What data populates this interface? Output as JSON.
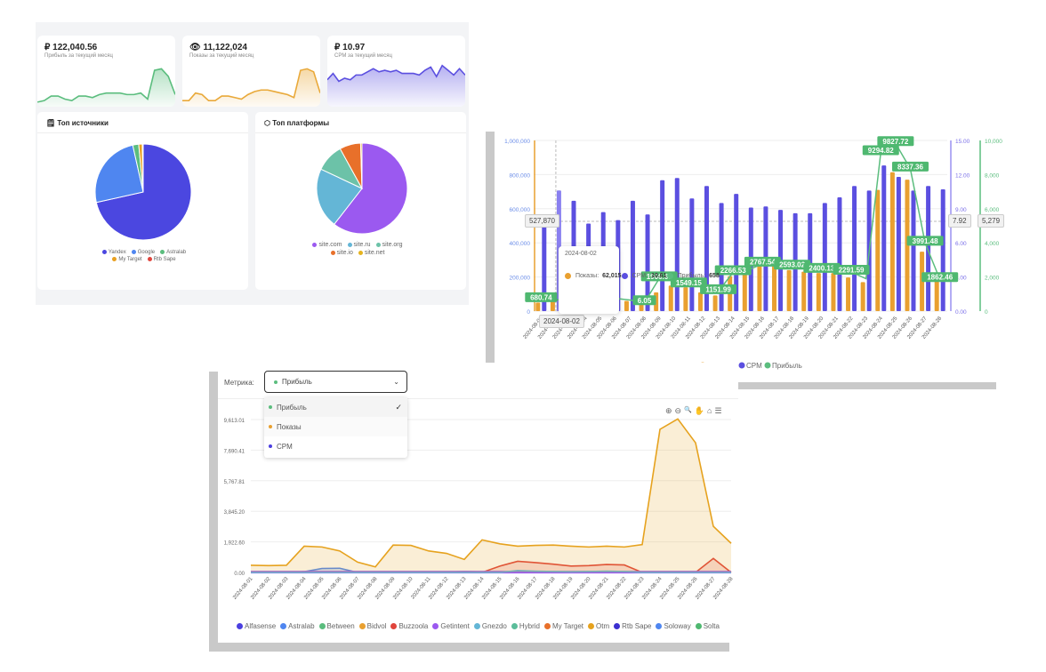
{
  "kpis": [
    {
      "value": "₽ 122,040.56",
      "label": "Прибыль за текущий месяц",
      "color": "#5bbd7e",
      "spark": [
        3,
        4,
        7,
        7,
        5,
        4,
        7,
        7,
        6,
        8,
        9,
        9,
        9,
        8,
        8,
        9,
        5,
        24,
        25,
        20,
        8
      ]
    },
    {
      "value": "11,122,024",
      "label": "Показы за текущий месяц",
      "color": "#e9a93a",
      "icon": "eye-icon",
      "spark": [
        4,
        4,
        9,
        8,
        4,
        4,
        7,
        7,
        6,
        5,
        8,
        10,
        11,
        11,
        10,
        9,
        8,
        6,
        24,
        25,
        23,
        9
      ]
    },
    {
      "value": "₽ 10.97",
      "label": "CPM за текущий месяц",
      "color": "#5b4fe0",
      "spark": [
        17,
        21,
        16,
        18,
        17,
        20,
        20,
        22,
        24,
        22,
        23,
        22,
        23,
        21,
        21,
        21,
        20,
        23,
        25,
        19,
        26,
        23,
        20,
        24,
        20
      ]
    }
  ],
  "sources": {
    "title": "Топ источники",
    "icon": "clipboard-icon",
    "chart_data": {
      "type": "pie",
      "labels": [
        "Yandex",
        "Google",
        "Astralab",
        "My Target",
        "Rtb Sape"
      ],
      "values": [
        71.5,
        25,
        2,
        1.2,
        0.3
      ],
      "colors": [
        "#4b47e0",
        "#4f86f0",
        "#5bbd7e",
        "#e9a020",
        "#e0443c"
      ]
    }
  },
  "platforms": {
    "title": "Топ платформы",
    "icon": "cube-icon",
    "chart_data": {
      "type": "pie",
      "labels": [
        "site.com",
        "site.ru",
        "site.org",
        "site.io",
        "site.net"
      ],
      "values": [
        60.5,
        21.5,
        10,
        7.5,
        0.5
      ],
      "colors": [
        "#9b59f0",
        "#64b6d6",
        "#6cc2a8",
        "#e8702a",
        "#e5b31e"
      ]
    }
  },
  "bar_chart": {
    "chart_data": {
      "type": "bar",
      "x": [
        "2024-08-01",
        "2024-08-02",
        "2024-08-03",
        "2024-08-04",
        "2024-08-05",
        "2024-08-06",
        "2024-08-07",
        "2024-08-08",
        "2024-08-09",
        "2024-08-10",
        "2024-08-11",
        "2024-08-12",
        "2024-08-13",
        "2024-08-14",
        "2024-08-15",
        "2024-08-16",
        "2024-08-17",
        "2024-08-18",
        "2024-08-19",
        "2024-08-20",
        "2024-08-21",
        "2024-08-22",
        "2024-08-23",
        "2024-08-24",
        "2024-08-25",
        "2024-08-26",
        "2024-08-27",
        "2024-08-28"
      ],
      "series": [
        {
          "name": "Показы",
          "type": "bar",
          "axis": "left",
          "color": "#e9a030",
          "values": [
            50000,
            62015,
            70000,
            80000,
            75000,
            70000,
            60000,
            55000,
            110000,
            150000,
            140000,
            110000,
            92000,
            205000,
            215000,
            275000,
            266000,
            240000,
            231000,
            223000,
            223000,
            197000,
            170000,
            710000,
            814000,
            770000,
            348000,
            180000
          ]
        },
        {
          "name": "CPM",
          "type": "bar",
          "axis": "right1",
          "color": "#5b4fe0",
          "values": [
            7.8,
            10.61,
            9.7,
            7.7,
            8.7,
            8.0,
            9.7,
            8.5,
            11.5,
            11.7,
            9.9,
            11.0,
            9.5,
            10.3,
            9.1,
            9.2,
            8.9,
            8.6,
            8.6,
            9.5,
            10.0,
            11.0,
            10.6,
            12.8,
            11.8,
            10.6,
            11.0,
            10.7
          ]
        },
        {
          "name": "Прибыль",
          "type": "line",
          "axis": "right2",
          "color": "#5bbd7e",
          "values": [
            680.74,
            658,
            700,
            900,
            800,
            750,
            650,
            506.05,
            1906.67,
            1850,
            1549.15,
            1400,
            1151.99,
            2266.53,
            2400,
            2767.54,
            2700,
            2593.02,
            2500,
            2400.13,
            2350,
            2291.59,
            1900,
            9294.82,
            9827.72,
            8337.36,
            3991.48,
            1862.46
          ]
        }
      ],
      "data_labels": [
        [
          "2024-08-01",
          "680.74"
        ],
        [
          "2024-08-08",
          "6.05"
        ],
        [
          "2024-08-09",
          "1906.67"
        ],
        [
          "2024-08-11",
          "1549.15"
        ],
        [
          "2024-08-13",
          "1151.99"
        ],
        [
          "2024-08-14",
          "2266.53"
        ],
        [
          "2024-08-16",
          "2767.54"
        ],
        [
          "2024-08-18",
          "2593.02"
        ],
        [
          "2024-08-20",
          "2400.13"
        ],
        [
          "2024-08-22",
          "2291.59"
        ],
        [
          "2024-08-24",
          "9294.82"
        ],
        [
          "2024-08-25",
          "9827.72"
        ],
        [
          "2024-08-26",
          "8337.36"
        ],
        [
          "2024-08-27",
          "3991.48"
        ],
        [
          "2024-08-28",
          "1862.46"
        ]
      ],
      "yleft": {
        "ticks": [
          "0",
          "200,000",
          "400,000",
          "600,000",
          "800,000",
          "1,000,000"
        ],
        "range": [
          0,
          1000000
        ]
      },
      "yright1": {
        "ticks": [
          "0.00",
          "3.00",
          "6.00",
          "9.00",
          "12.00",
          "15.00"
        ],
        "range": [
          0,
          15
        ]
      },
      "yright2": {
        "ticks": [
          "0",
          "2,000",
          "4,000",
          "6,000",
          "8,000",
          "10,000"
        ],
        "range": [
          0,
          10000
        ]
      },
      "legend": "bottom",
      "grid": true
    },
    "crosshair": {
      "left": "527,870",
      "cpm": "7.92",
      "profit": "5,279",
      "x": "2024-08-02"
    },
    "tooltip": {
      "date": "2024-08-02",
      "rows": [
        {
          "label": "Показы:",
          "value": "62,015",
          "color": "#e9a030"
        },
        {
          "label": "CPM:",
          "value": "10.61",
          "color": "#5b4fe0"
        },
        {
          "label": "Прибыль:",
          "value": "658",
          "color": "#5bbd7e"
        }
      ]
    }
  },
  "line_chart": {
    "metric_label": "Метрика:",
    "selected": "Прибыль",
    "selected_color": "#5bbd7e",
    "options": [
      {
        "label": "Прибыль",
        "color": "#5bbd7e",
        "checked": true
      },
      {
        "label": "Показы",
        "color": "#e9a030"
      },
      {
        "label": "CPM",
        "color": "#4b3fe0"
      }
    ],
    "toolbar": [
      "zoom-in-icon",
      "zoom-out-icon",
      "search-icon",
      "hand-icon",
      "home-icon",
      "menu-icon"
    ],
    "chart_data": {
      "type": "area",
      "yticks": [
        "0.00",
        "1,922.60",
        "3,845.20",
        "5,767.81",
        "7,690.41",
        "9,613.01"
      ],
      "ylim": [
        0,
        9613.01
      ],
      "legend": "bottom",
      "grid": true,
      "x": [
        "2024-08-01",
        "2024-08-02",
        "2024-08-03",
        "2024-08-04",
        "2024-08-05",
        "2024-08-06",
        "2024-08-07",
        "2024-08-08",
        "2024-08-09",
        "2024-08-10",
        "2024-08-11",
        "2024-08-12",
        "2024-08-13",
        "2024-08-14",
        "2024-08-15",
        "2024-08-16",
        "2024-08-17",
        "2024-08-18",
        "2024-08-19",
        "2024-08-20",
        "2024-08-21",
        "2024-08-22",
        "2024-08-23",
        "2024-08-24",
        "2024-08-25",
        "2024-08-26",
        "2024-08-27",
        "2024-08-28"
      ],
      "series": [
        {
          "name": "Alfasense",
          "color": "#4b3fe0",
          "values": [
            0,
            0,
            0,
            0,
            0,
            0,
            0,
            0,
            0,
            0,
            0,
            0,
            0,
            0,
            0,
            0,
            0,
            0,
            0,
            0,
            0,
            0,
            0,
            0,
            0,
            0,
            0,
            0
          ]
        },
        {
          "name": "Astralab",
          "color": "#4f86f0",
          "values": [
            0,
            0,
            0,
            50,
            250,
            260,
            0,
            0,
            30,
            30,
            0,
            20,
            60,
            30,
            0,
            0,
            0,
            0,
            0,
            0,
            0,
            0,
            0,
            40,
            0,
            0,
            0,
            0
          ]
        },
        {
          "name": "Between",
          "color": "#5bbd7e",
          "values": [
            0,
            0,
            0,
            0,
            0,
            0,
            0,
            0,
            0,
            0,
            0,
            0,
            0,
            0,
            0,
            0,
            0,
            0,
            0,
            0,
            0,
            0,
            0,
            0,
            0,
            0,
            0,
            0
          ]
        },
        {
          "name": "Bidvol",
          "color": "#e9a030",
          "values": [
            0,
            0,
            0,
            0,
            0,
            0,
            0,
            0,
            0,
            0,
            0,
            0,
            0,
            0,
            0,
            0,
            0,
            0,
            0,
            0,
            0,
            0,
            0,
            0,
            0,
            0,
            0,
            0
          ]
        },
        {
          "name": "Buzzoola",
          "color": "#e0443c",
          "values": [
            0,
            0,
            0,
            0,
            0,
            0,
            0,
            0,
            0,
            0,
            0,
            0,
            0,
            0,
            400,
            700,
            620,
            520,
            400,
            430,
            500,
            470,
            0,
            0,
            0,
            0,
            880,
            0
          ]
        },
        {
          "name": "Getintent",
          "color": "#9b59f0",
          "values": [
            20,
            20,
            20,
            20,
            20,
            20,
            20,
            20,
            20,
            20,
            20,
            20,
            20,
            20,
            20,
            20,
            20,
            20,
            20,
            20,
            20,
            20,
            20,
            20,
            20,
            20,
            20,
            20
          ]
        },
        {
          "name": "Gnezdo",
          "color": "#64b6d6",
          "values": [
            0,
            0,
            0,
            0,
            0,
            0,
            0,
            0,
            0,
            0,
            0,
            0,
            0,
            0,
            0,
            120,
            80,
            60,
            40,
            60,
            80,
            60,
            0,
            0,
            0,
            0,
            0,
            0
          ]
        },
        {
          "name": "Hybrid",
          "color": "#5bbd9a",
          "values": [
            0,
            0,
            0,
            0,
            0,
            0,
            0,
            0,
            0,
            0,
            0,
            0,
            0,
            0,
            0,
            0,
            0,
            0,
            0,
            0,
            0,
            0,
            0,
            0,
            0,
            0,
            0,
            0
          ]
        },
        {
          "name": "My Target",
          "color": "#e8702a",
          "values": [
            0,
            0,
            0,
            0,
            0,
            0,
            0,
            0,
            0,
            0,
            0,
            0,
            0,
            0,
            0,
            0,
            0,
            0,
            0,
            0,
            0,
            0,
            0,
            0,
            0,
            0,
            0,
            0
          ]
        },
        {
          "name": "Otm",
          "color": "#e6a21e",
          "values": [
            450,
            430,
            450,
            1650,
            1600,
            1350,
            650,
            350,
            1720,
            1700,
            1350,
            1200,
            820,
            2050,
            1800,
            1650,
            1700,
            1720,
            1650,
            1600,
            1650,
            1600,
            1750,
            9000,
            9650,
            8150,
            2900,
            1830
          ]
        },
        {
          "name": "Rtb Sape",
          "color": "#3b2fd0",
          "values": [
            0,
            0,
            0,
            0,
            0,
            0,
            0,
            0,
            0,
            0,
            0,
            0,
            0,
            0,
            0,
            0,
            0,
            0,
            0,
            0,
            0,
            0,
            0,
            0,
            0,
            0,
            0,
            0
          ]
        },
        {
          "name": "Soloway",
          "color": "#4f86f0",
          "values": [
            0,
            0,
            0,
            0,
            0,
            0,
            0,
            0,
            0,
            0,
            0,
            0,
            0,
            0,
            0,
            0,
            0,
            0,
            0,
            0,
            0,
            0,
            0,
            0,
            0,
            0,
            0,
            0
          ]
        },
        {
          "name": "Solta",
          "color": "#4fb870",
          "values": [
            0,
            0,
            0,
            0,
            0,
            0,
            0,
            0,
            0,
            0,
            0,
            0,
            0,
            0,
            0,
            0,
            0,
            0,
            0,
            0,
            0,
            0,
            0,
            0,
            0,
            0,
            0,
            0
          ]
        }
      ]
    }
  }
}
